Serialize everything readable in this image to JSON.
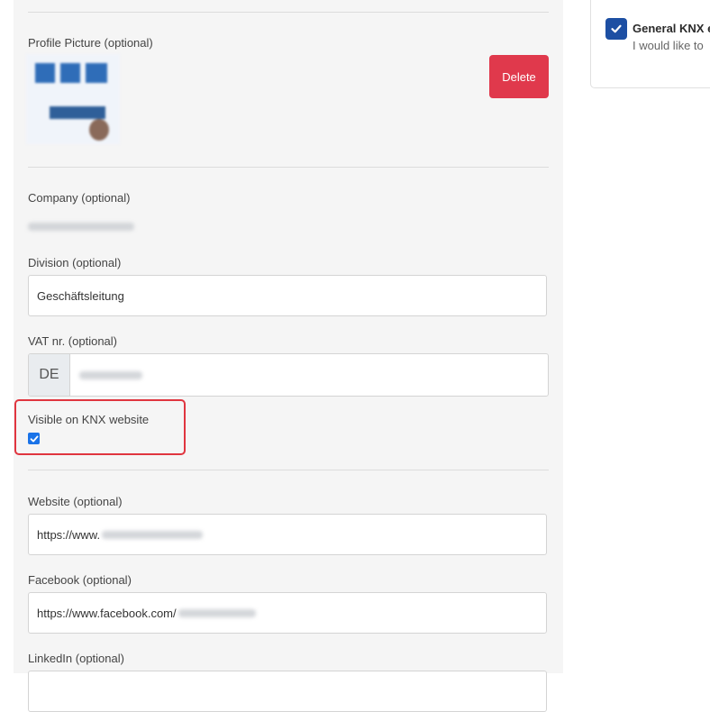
{
  "form": {
    "profile_picture_label": "Profile Picture (optional)",
    "delete_label": "Delete",
    "company_label": "Company (optional)",
    "division_label": "Division (optional)",
    "division_value": "Geschäftsleitung",
    "vat_label": "VAT nr. (optional)",
    "vat_prefix": "DE",
    "visible_label": "Visible on KNX website",
    "website_label": "Website (optional)",
    "website_value": "https://www.",
    "facebook_label": "Facebook (optional)",
    "facebook_value": "https://www.facebook.com/",
    "linkedin_label": "LinkedIn (optional)"
  },
  "consent": {
    "title": "General KNX e",
    "text": "I would like to"
  },
  "colors": {
    "delete_button": "#e0394c",
    "checkbox": "#1d4fa3",
    "highlight": "#e0353f"
  }
}
